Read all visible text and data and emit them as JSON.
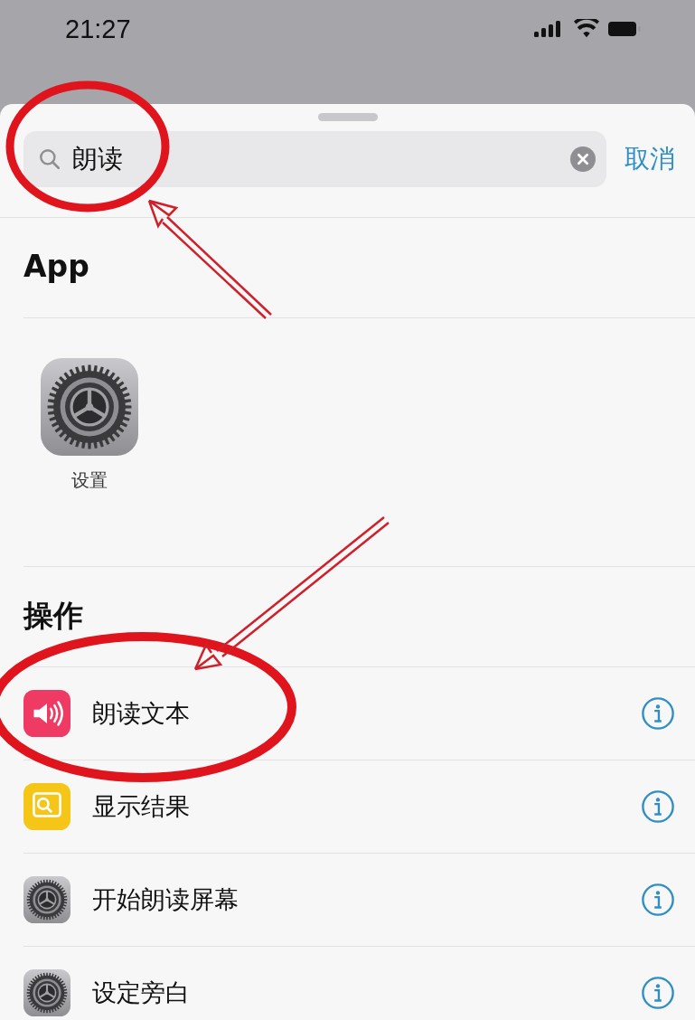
{
  "status_bar": {
    "time": "21:27"
  },
  "search": {
    "value": "朗读",
    "cancel": "取消"
  },
  "sections": [
    {
      "title": "App",
      "kind": "grid",
      "items": [
        {
          "label": "设置",
          "kind": "gear"
        }
      ]
    },
    {
      "title": "操作",
      "kind": "list",
      "items": [
        {
          "label": "朗读文本",
          "kind": "speaker"
        },
        {
          "label": "显示结果",
          "kind": "result"
        },
        {
          "label": "开始朗读屏幕",
          "kind": "gear"
        },
        {
          "label": "设定旁白",
          "kind": "gear"
        }
      ]
    }
  ]
}
